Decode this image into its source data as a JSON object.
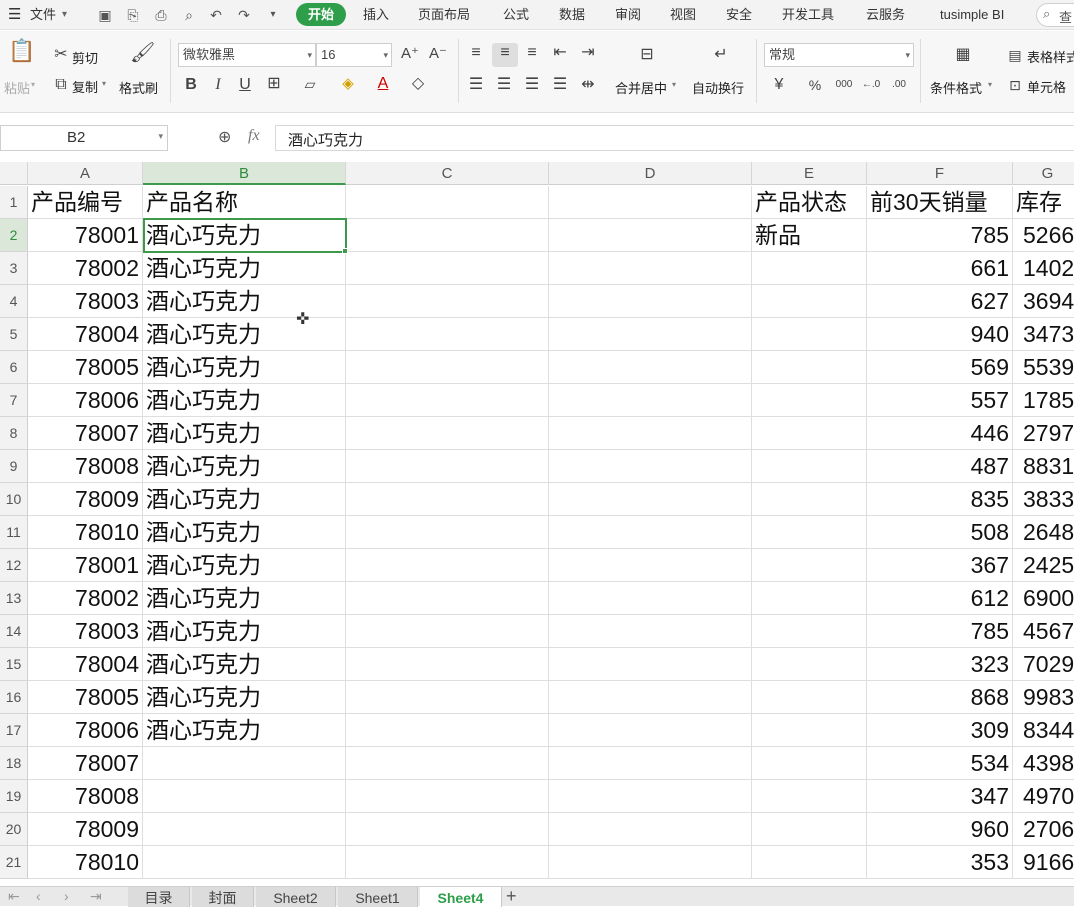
{
  "menu": {
    "file": "文件",
    "tabs": [
      "开始",
      "插入",
      "页面布局",
      "公式",
      "数据",
      "审阅",
      "视图",
      "安全",
      "开发工具",
      "云服务",
      "tusimple BI"
    ],
    "search_glyph": "查"
  },
  "ribbon": {
    "paste": "粘贴",
    "cut": "剪切",
    "copy": "复制",
    "format_painter": "格式刷",
    "font_name": "微软雅黑",
    "font_size": "16",
    "merge_center": "合并居中",
    "wrap_text": "自动换行",
    "number_format": "常规",
    "conditional_format": "条件格式",
    "table_style": "表格样式",
    "cell_style": "单元格",
    "bold": "B",
    "italic": "I",
    "underline": "U",
    "grow_font": "A⁺",
    "shrink_font": "A⁻",
    "currency": "¥",
    "percent": "%",
    "thousands": "000",
    "inc_decimal": "←.0",
    "dec_decimal": ".00"
  },
  "formula_bar": {
    "name_box": "B2",
    "fx": "fx",
    "content": "酒心巧克力"
  },
  "columns": [
    "A",
    "B",
    "C",
    "D",
    "E",
    "F",
    "G"
  ],
  "selected_cell": "B2",
  "rows": [
    {
      "n": "1",
      "a": "产品编号",
      "b": "产品名称",
      "e": "产品状态",
      "f": "前30天销量",
      "g": "库存"
    },
    {
      "n": "2",
      "a": "78001",
      "b": "酒心巧克力",
      "e": "新品",
      "f": "785",
      "g": "5266"
    },
    {
      "n": "3",
      "a": "78002",
      "b": "酒心巧克力",
      "e": "",
      "f": "661",
      "g": "1402"
    },
    {
      "n": "4",
      "a": "78003",
      "b": "酒心巧克力",
      "e": "",
      "f": "627",
      "g": "3694"
    },
    {
      "n": "5",
      "a": "78004",
      "b": "酒心巧克力",
      "e": "",
      "f": "940",
      "g": "3473"
    },
    {
      "n": "6",
      "a": "78005",
      "b": "酒心巧克力",
      "e": "",
      "f": "569",
      "g": "5539"
    },
    {
      "n": "7",
      "a": "78006",
      "b": "酒心巧克力",
      "e": "",
      "f": "557",
      "g": "1785"
    },
    {
      "n": "8",
      "a": "78007",
      "b": "酒心巧克力",
      "e": "",
      "f": "446",
      "g": "2797"
    },
    {
      "n": "9",
      "a": "78008",
      "b": "酒心巧克力",
      "e": "",
      "f": "487",
      "g": "8831"
    },
    {
      "n": "10",
      "a": "78009",
      "b": "酒心巧克力",
      "e": "",
      "f": "835",
      "g": "3833"
    },
    {
      "n": "11",
      "a": "78010",
      "b": "酒心巧克力",
      "e": "",
      "f": "508",
      "g": "2648"
    },
    {
      "n": "12",
      "a": "78001",
      "b": "酒心巧克力",
      "e": "",
      "f": "367",
      "g": "2425"
    },
    {
      "n": "13",
      "a": "78002",
      "b": "酒心巧克力",
      "e": "",
      "f": "612",
      "g": "6900"
    },
    {
      "n": "14",
      "a": "78003",
      "b": "酒心巧克力",
      "e": "",
      "f": "785",
      "g": "4567"
    },
    {
      "n": "15",
      "a": "78004",
      "b": "酒心巧克力",
      "e": "",
      "f": "323",
      "g": "7029"
    },
    {
      "n": "16",
      "a": "78005",
      "b": "酒心巧克力",
      "e": "",
      "f": "868",
      "g": "9983"
    },
    {
      "n": "17",
      "a": "78006",
      "b": "酒心巧克力",
      "e": "",
      "f": "309",
      "g": "8344"
    },
    {
      "n": "18",
      "a": "78007",
      "b": "",
      "e": "",
      "f": "534",
      "g": "4398"
    },
    {
      "n": "19",
      "a": "78008",
      "b": "",
      "e": "",
      "f": "347",
      "g": "4970"
    },
    {
      "n": "20",
      "a": "78009",
      "b": "",
      "e": "",
      "f": "960",
      "g": "2706"
    },
    {
      "n": "21",
      "a": "78010",
      "b": "",
      "e": "",
      "f": "353",
      "g": "9166"
    }
  ],
  "sheet_tabs": [
    "目录",
    "封面",
    "Sheet2",
    "Sheet1",
    "Sheet4"
  ],
  "active_sheet": "Sheet4",
  "colors": {
    "accent": "#2e9e4a",
    "selection": "#3c9a4a"
  }
}
